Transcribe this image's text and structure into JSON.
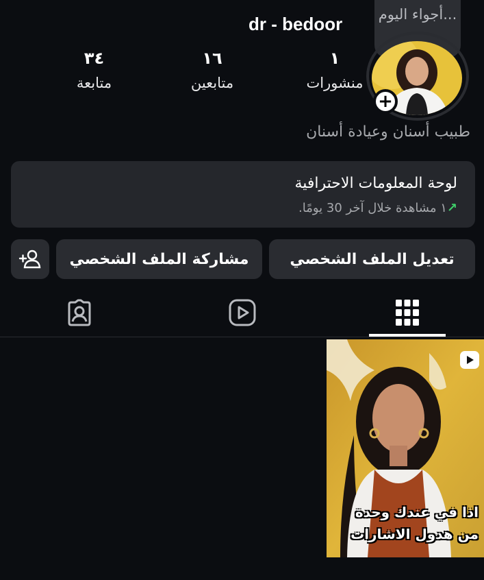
{
  "profile": {
    "username": "dr - bedoor",
    "note": "أجواء اليوم...",
    "bio": "طبيب أسنان وعيادة أسنان",
    "stats": [
      {
        "value": "١",
        "label": "منشورات"
      },
      {
        "value": "١٦",
        "label": "متابعين"
      },
      {
        "value": "٣٤",
        "label": "متابعة"
      }
    ]
  },
  "dashboard": {
    "title": "لوحة المعلومات الاحترافية",
    "arrow": "↗",
    "subtitle": "١ مشاهدة خلال آخر 30 يومًا.",
    "arrow_color": "#3fcf6a"
  },
  "buttons": {
    "edit_profile": "تعديل الملف الشخصي",
    "share_profile": "مشاركة الملف الشخصي"
  },
  "tabs": [
    {
      "icon": "grid-icon",
      "active": true
    },
    {
      "icon": "reels-icon",
      "active": false
    },
    {
      "icon": "tagged-icon",
      "active": false
    }
  ],
  "post": {
    "type": "reel",
    "caption_line1": "اذا في عندك وحدة",
    "caption_line2": "من هدول الاشارات"
  },
  "colors": {
    "background": "#0b0d11",
    "surface": "#25272c",
    "button": "#2a2c31"
  }
}
